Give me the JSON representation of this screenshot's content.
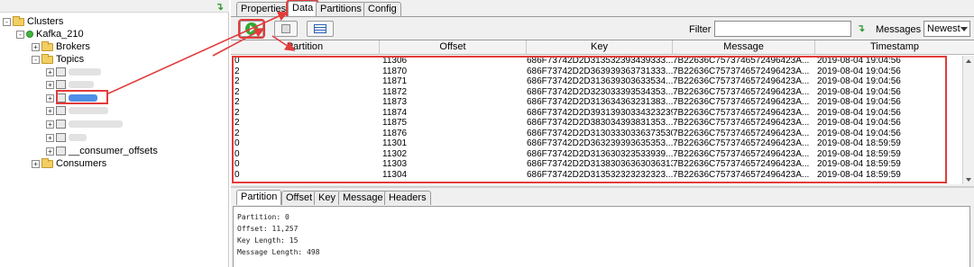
{
  "tree": {
    "refresh_icon": "refresh-arrow-icon",
    "nodes": {
      "clusters": "Clusters",
      "cluster": "Kafka_210",
      "brokers": "Brokers",
      "topics": "Topics",
      "consumer_offsets": "__consumer_offsets",
      "consumers": "Consumers"
    }
  },
  "tabs": [
    "Properties",
    "Data",
    "Partitions",
    "Config"
  ],
  "toolbar": {
    "filter_label": "Filter",
    "filter_value": "",
    "messages_label": "Messages",
    "messages_selected": "Newest"
  },
  "grid": {
    "columns": [
      "Partition",
      "Offset",
      "Key",
      "Message",
      "Timestamp"
    ],
    "rows": [
      [
        "0",
        "11306",
        "686F73742D2D313532393439333...",
        "7B22636C7573746572496423A...",
        "2019-08-04 19:04:56"
      ],
      [
        "2",
        "11870",
        "686F73742D2D363939363731333...",
        "7B22636C7573746572496423A...",
        "2019-08-04 19:04:56"
      ],
      [
        "2",
        "11871",
        "686F73742D2D313639303633534...",
        "7B22636C7573746572496423A...",
        "2019-08-04 19:04:56"
      ],
      [
        "2",
        "11872",
        "686F73742D2D323033393534353...",
        "7B22636C7573746572496423A...",
        "2019-08-04 19:04:56"
      ],
      [
        "2",
        "11873",
        "686F73742D2D313634363231383...",
        "7B22636C7573746572496423A...",
        "2019-08-04 19:04:56"
      ],
      [
        "2",
        "11874",
        "686F73742D2D3931393033432323933",
        "7B22636C7573746572496423A...",
        "2019-08-04 19:04:56"
      ],
      [
        "2",
        "11875",
        "686F73742D2D383034393831353...",
        "7B22636C7573746572496423A...",
        "2019-08-04 19:04:56"
      ],
      [
        "2",
        "11876",
        "686F73742D2D313033303363735303...",
        "7B22636C7573746572496423A...",
        "2019-08-04 19:04:56"
      ],
      [
        "0",
        "11301",
        "686F73742D2D363239393635353...",
        "7B22636C7573746572496423A...",
        "2019-08-04 18:59:59"
      ],
      [
        "0",
        "11302",
        "686F73742D2D313630323533939...",
        "7B22636C7573746572496423A...",
        "2019-08-04 18:59:59"
      ],
      [
        "0",
        "11303",
        "686F73742D2D313830363630363131...",
        "7B22636C7573746572496423A...",
        "2019-08-04 18:59:59"
      ],
      [
        "0",
        "11304",
        "686F73742D2D313532323232323...",
        "7B22636C7573746572496423A...",
        "2019-08-04 18:59:59"
      ]
    ]
  },
  "detail": {
    "tabs": [
      "Partition",
      "Offset",
      "Key",
      "Message",
      "Headers"
    ],
    "lines": [
      "Partition: 0",
      "Offset: 11,257",
      "Key Length: 15",
      "Message Length: 498"
    ]
  },
  "colors": {
    "annotation": "#e23b3b",
    "accent_green": "#33a833",
    "selection": "#4f8fe8"
  }
}
